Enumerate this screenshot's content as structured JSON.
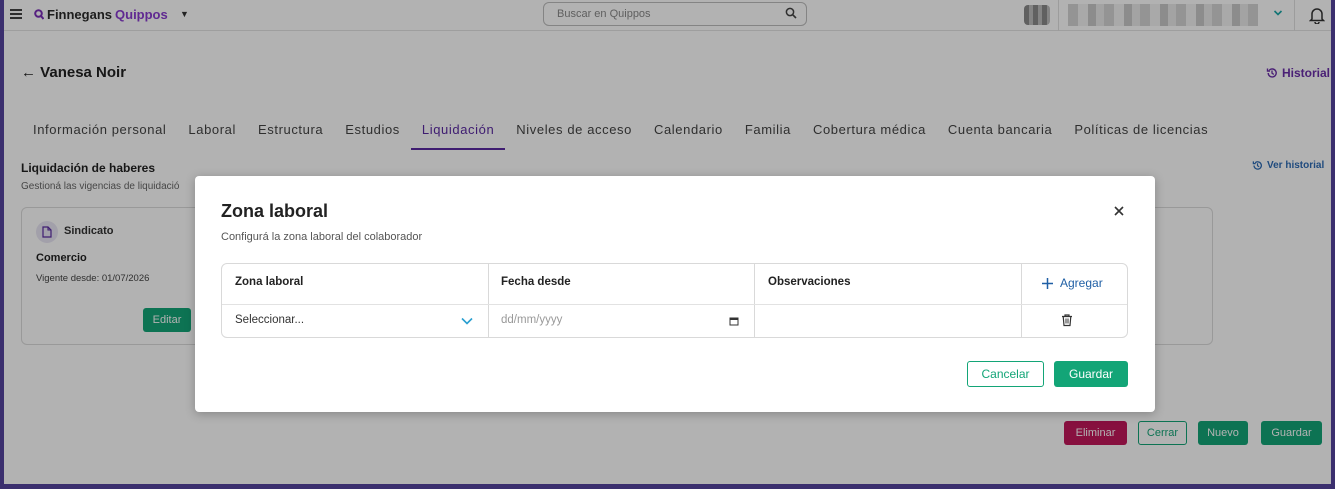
{
  "topbar": {
    "logo_prefix": "Finnegans",
    "logo_brand": "Quippos",
    "search_placeholder": "Buscar en Quippos"
  },
  "page": {
    "back_title": "Vanesa Noir",
    "historial_label": "Historial",
    "tabs": [
      {
        "label": "Información personal"
      },
      {
        "label": "Laboral"
      },
      {
        "label": "Estructura"
      },
      {
        "label": "Estudios"
      },
      {
        "label": "Liquidación",
        "active": true
      },
      {
        "label": "Niveles de acceso"
      },
      {
        "label": "Calendario"
      },
      {
        "label": "Familia"
      },
      {
        "label": "Cobertura médica"
      },
      {
        "label": "Cuenta bancaria"
      },
      {
        "label": "Políticas de licencias"
      }
    ],
    "section_title": "Liquidación de haberes",
    "section_subtitle": "Gestioná las vigencias de liquidació",
    "ver_historial_label": "Ver historial",
    "card": {
      "kind": "Sindicato",
      "name": "Comercio",
      "vigente": "Vigente desde: 01/07/2026",
      "edit_label": "Editar"
    },
    "bottom": {
      "eliminar": "Eliminar",
      "cerrar": "Cerrar",
      "nuevo": "Nuevo",
      "guardar": "Guardar"
    }
  },
  "modal": {
    "title": "Zona laboral",
    "subtitle": "Configurá la zona laboral del colaborador",
    "columns": {
      "zona": "Zona laboral",
      "fecha": "Fecha desde",
      "observaciones": "Observaciones"
    },
    "add_label": "Agregar",
    "row": {
      "zona_placeholder": "Seleccionar...",
      "fecha_placeholder": "dd/mm/yyyy",
      "observaciones": ""
    },
    "cancel_label": "Cancelar",
    "save_label": "Guardar"
  },
  "colors": {
    "accent_purple": "#5b2aa3",
    "primary_green": "#13a577",
    "danger_magenta": "#c2185b",
    "link_blue": "#1f5fa5"
  },
  "icons": [
    "menu-icon",
    "search-icon",
    "chevron-down-icon",
    "bell-icon",
    "back-arrow-icon",
    "history-icon",
    "document-icon",
    "close-icon",
    "plus-icon",
    "calendar-icon",
    "trash-icon"
  ]
}
